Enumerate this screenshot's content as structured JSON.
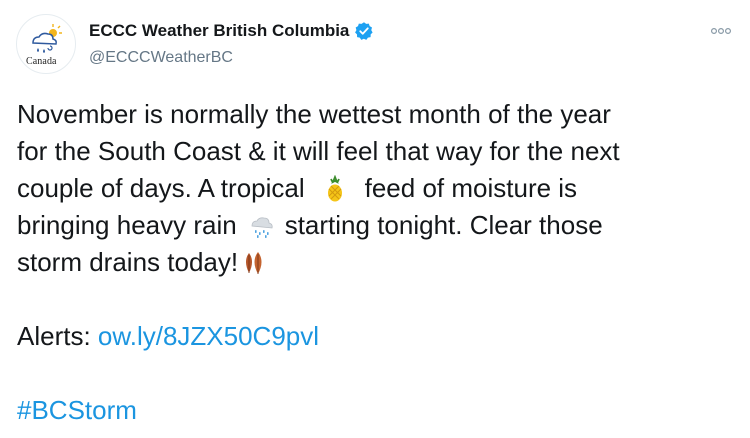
{
  "author": {
    "display_name": "ECCC Weather British Columbia",
    "handle": "@ECCCWeatherBC",
    "avatar_wordmark": "Canada",
    "verified": true
  },
  "tweet": {
    "line1": "November is normally the wettest month of the year",
    "line2": "for the South Coast & it will feel that way for the next",
    "line3_a": "couple of days. A tropical",
    "line3_b": "feed of moisture is",
    "line4_a": "bringing heavy rain",
    "line4_b": "starting tonight. Clear those",
    "line5": "storm drains today!",
    "alerts_label": "Alerts:",
    "alerts_link": "ow.ly/8JZX50C9pvl",
    "hashtag": "#BCStorm"
  },
  "icons": {
    "avatar": "weather-logo-icon",
    "verified": "verified-badge-icon",
    "more": "more-options-icon",
    "emoji_1": "pineapple-emoji",
    "emoji_2": "rain-cloud-emoji",
    "emoji_3": "fallen-leaves-emoji"
  },
  "colors": {
    "link": "#1b95e0",
    "verified": "#1da1f2",
    "text": "#14171a",
    "secondary": "#657786"
  }
}
